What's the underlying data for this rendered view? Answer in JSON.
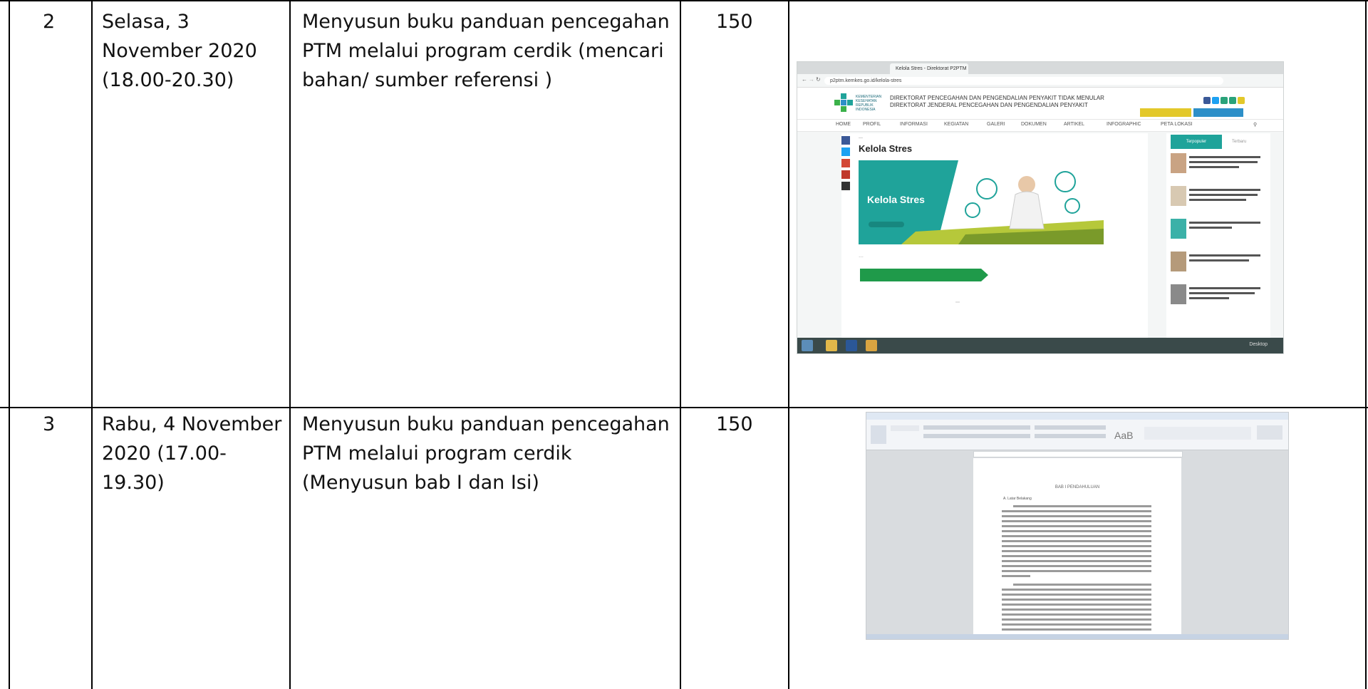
{
  "rows": [
    {
      "no": "2",
      "date_lines": [
        "Selasa, 3",
        "November 2020",
        "(18.00-20.30)"
      ],
      "activity_lines": [
        "Menyusun buku panduan pencegahan",
        "PTM melalui program cerdik (mencari",
        "bahan/ sumber referensi )"
      ],
      "volume": "150"
    },
    {
      "no": "3",
      "date_lines": [
        "Rabu, 4 November",
        "2020 (17.00-19.30)"
      ],
      "activity_lines": [
        "Menyusun buku panduan pencegahan",
        "PTM melalui program cerdik",
        "(Menyusun  bab I dan Isi)"
      ],
      "volume": "150"
    }
  ],
  "evidence_browser": {
    "tab_title": "Kelola Stres - Direktorat P2PTM",
    "url": "p2ptm.kemkes.go.id/kelola-stres",
    "ministry_lines": [
      "KEMENTERIAN",
      "KESEHATAN",
      "REPUBLIK",
      "INDONESIA"
    ],
    "directorate_lines": [
      "DIREKTORAT PENCEGAHAN DAN PENGENDALIAN PENYAKIT TIDAK MENULAR",
      "DIREKTORAT JENDERAL PENCEGAHAN DAN PENGENDALIAN PENYAKIT"
    ],
    "nav": [
      "HOME",
      "PROFIL",
      "INFORMASI",
      "KEGIATAN",
      "GALERI",
      "DOKUMEN",
      "ARTIKEL",
      "INFOGRAPHIC",
      "PETA LOKASI"
    ],
    "article_title": "Kelola Stres",
    "banner_text": "Kelola Stres",
    "sidebar_tab": "Terpopuler",
    "sidebar_tab2": "Terbaru",
    "taskbar_right": "Desktop",
    "colors": {
      "teal": "#1fa39a",
      "green": "#1f9a4a",
      "yellow": "#e3c82a"
    }
  },
  "evidence_word": {
    "font_preview": "AaB",
    "doc_heading": "BAB I PENDAHULUAN",
    "doc_subheading": "A. Latar Belakang"
  }
}
